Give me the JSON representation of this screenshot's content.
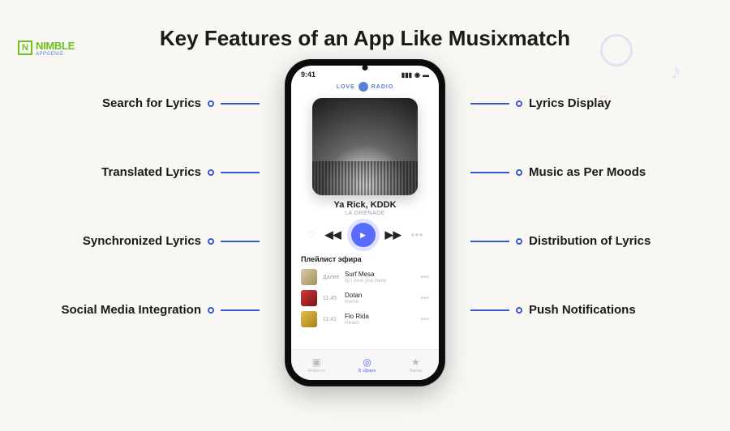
{
  "logo": {
    "letter": "N",
    "brand": "NIMBLE",
    "sub": "APPGENIE"
  },
  "title": "Key Features of an App Like Musixmatch",
  "features": {
    "left": [
      "Search for Lyrics",
      "Translated Lyrics",
      "Synchronized Lyrics",
      "Social Media Integration"
    ],
    "right": [
      "Lyrics Display",
      "Music as Per Moods",
      "Distribution of Lyrics",
      "Push Notifications"
    ]
  },
  "phone": {
    "time": "9:41",
    "radio_brand_left": "LOVE",
    "radio_brand_right": "RADIO",
    "track": "Ya Rick, KDDK",
    "track_sub": "LA GRENADE",
    "playlist_label": "Плейлист эфира",
    "playlist": [
      {
        "time": "Далее",
        "track": "Surf Mesa",
        "artist": "ily i love you baby"
      },
      {
        "time": "11:45",
        "track": "Dotan",
        "artist": "Numb"
      },
      {
        "time": "11:41",
        "track": "Flo Rida",
        "artist": "Низко"
      }
    ],
    "tabs": [
      {
        "icon": "▣",
        "label": "Новости"
      },
      {
        "icon": "◎",
        "label": "В эфире"
      },
      {
        "icon": "★",
        "label": "Чарты"
      }
    ]
  }
}
